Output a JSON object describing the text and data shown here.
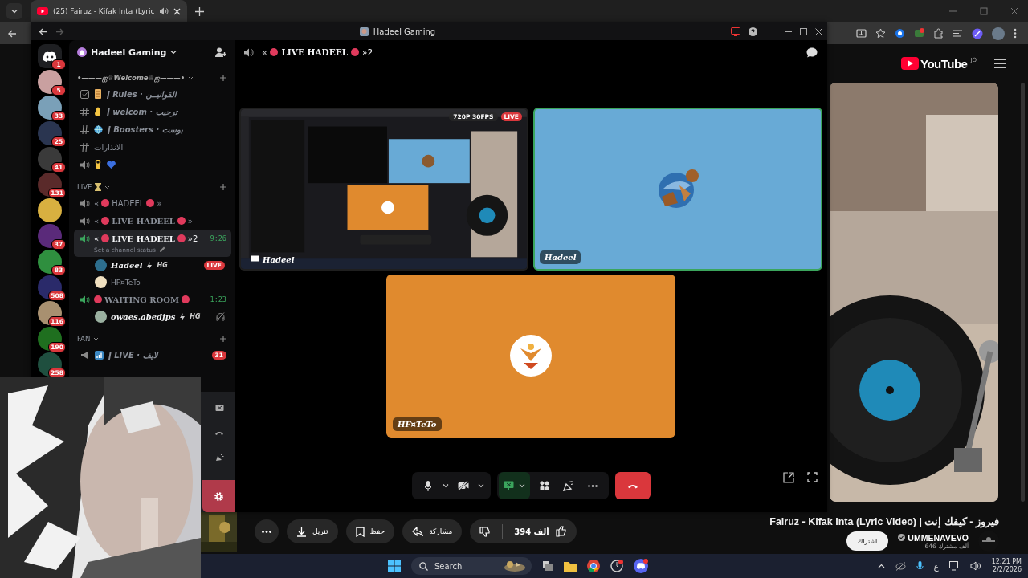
{
  "browser": {
    "tab": {
      "title": "(25) Fairuz - Kifak Inta (Lyric",
      "playing_audio": true
    }
  },
  "discord": {
    "title": "Hadeel Gaming",
    "server_name": "Hadeel Gaming",
    "servers": [
      {
        "kind": "home",
        "badge": "1"
      },
      {
        "kind": "server",
        "badge": "5"
      },
      {
        "kind": "server",
        "badge": "33"
      },
      {
        "kind": "server",
        "badge": "25"
      },
      {
        "kind": "server",
        "badge": "41"
      },
      {
        "kind": "server",
        "badge": "131"
      },
      {
        "kind": "server"
      },
      {
        "kind": "server",
        "badge": "37"
      },
      {
        "kind": "server",
        "badge": "83"
      },
      {
        "kind": "server",
        "badge": "508"
      },
      {
        "kind": "server",
        "badge": "116"
      },
      {
        "kind": "server",
        "badge": "190"
      },
      {
        "kind": "server",
        "badge": "258"
      }
    ],
    "channels": [
      {
        "kind": "category",
        "name": "•———ஐ♕Welcome♕ஐ———•"
      },
      {
        "kind": "rules",
        "name": "ǀ Rules · القوانيــن"
      },
      {
        "kind": "text",
        "name": "ǀ welcom · ترحيب"
      },
      {
        "kind": "text",
        "name": "ǀ Boosters · بوست"
      },
      {
        "kind": "text",
        "name": "الانذارات"
      },
      {
        "kind": "voice-emoji"
      },
      {
        "kind": "category",
        "name": "LIVE"
      },
      {
        "kind": "voice",
        "prefix": "«",
        "name": "HADEEL",
        "suffix": "»",
        "selected": false
      },
      {
        "kind": "voice",
        "prefix": "«",
        "name": "LIVE HADEEL",
        "suffix": "»",
        "selected": false
      },
      {
        "kind": "voice",
        "prefix": "«",
        "name": "LIVE HADEEL",
        "suffix": "»2",
        "selected": true,
        "time": "9:26",
        "status_placeholder": "Set a channel status",
        "members": [
          {
            "name": "Hadeel",
            "tag": "HG",
            "badge": "LIVE",
            "deafened": false
          },
          {
            "name": "HF¤TeTo",
            "deafened": false
          }
        ]
      },
      {
        "kind": "voice",
        "name": "WAITING ROOM",
        "selected": false,
        "time": "1:23",
        "members": [
          {
            "name": "owaes.abedjps",
            "tag": "HG",
            "deafened": true
          }
        ]
      },
      {
        "kind": "category",
        "name": "FAN"
      },
      {
        "kind": "announcement",
        "name": "ǀ LIVE · لايف",
        "badge": "31"
      }
    ],
    "call": {
      "prefix": "«",
      "name": "LIVE HADEEL",
      "suffix": "»2",
      "tiles": [
        {
          "kind": "screen",
          "name": "Hadeel",
          "quality": "720P 30FPS",
          "badge": "LIVE",
          "speaking": false
        },
        {
          "kind": "avatar",
          "name": "Hadeel",
          "speaking": true,
          "color": "#68aad6"
        },
        {
          "kind": "avatar",
          "name": "HF¤TeTo",
          "speaking": false,
          "color": "#e08a2e"
        }
      ],
      "mic_muted": false,
      "camera_on": false,
      "screen_sharing": true
    }
  },
  "youtube": {
    "logo": "YouTube",
    "region": "JO",
    "title": "Fairuz - Kifak Inta (Lyric Video) | فيروز - كيفك إنت",
    "channel": "UMMENAVEVO",
    "verified": true,
    "subscribers": "646 ألف مشترك",
    "subscribe": "اشتراك",
    "likes": "394 ألف",
    "actions": [
      {
        "kind": "share",
        "label": "مشاركة"
      },
      {
        "kind": "save",
        "label": "حفظ"
      },
      {
        "kind": "download",
        "label": "تنزيل"
      }
    ]
  },
  "taskbar": {
    "search": "Search",
    "keyboard": "ع",
    "time": "12:21 PM",
    "date": "2/2/2026"
  }
}
